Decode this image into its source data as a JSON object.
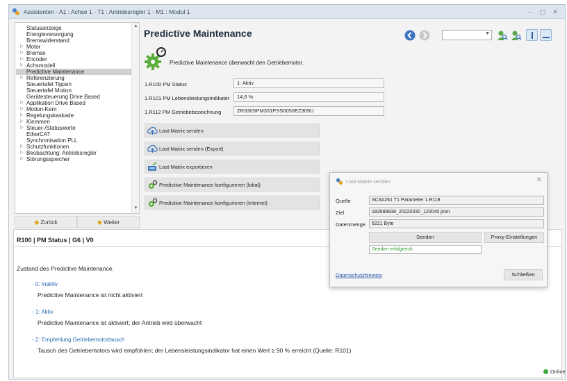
{
  "window": {
    "title": "Assistenten - A1 : Achse 1 - T1 : Antriebsregler 1 - M1 : Modul 1",
    "minimize": "–",
    "maximize": "▢",
    "close": "✕"
  },
  "nav": {
    "items": [
      {
        "label": "Statusanzeige",
        "selected": false
      },
      {
        "label": "Energieversorgung",
        "selected": false
      },
      {
        "label": "Bremswiderstand",
        "selected": false
      },
      {
        "label": "Motor",
        "selected": false,
        "expandable": true
      },
      {
        "label": "Bremse",
        "selected": false,
        "expandable": true
      },
      {
        "label": "Encoder",
        "selected": false,
        "expandable": true
      },
      {
        "label": "Achsmodell",
        "selected": false,
        "expandable": true
      },
      {
        "label": "Predictive Maintenance",
        "selected": true
      },
      {
        "label": "Referenzierung",
        "selected": false,
        "expandable": true
      },
      {
        "label": "Steuertafel Tippen",
        "selected": false
      },
      {
        "label": "Steuertafel Motion",
        "selected": false
      },
      {
        "label": "Gerätesteuerung Drive Based",
        "selected": false
      },
      {
        "label": "Applikation Drive Based",
        "selected": false,
        "expandable": true
      },
      {
        "label": "Motion-Kern",
        "selected": false,
        "expandable": true
      },
      {
        "label": "Regelungskaskade",
        "selected": false,
        "expandable": true
      },
      {
        "label": "Klemmen",
        "selected": false,
        "expandable": true
      },
      {
        "label": "Steuer-/Statusworte",
        "selected": false,
        "expandable": true
      },
      {
        "label": "EtherCAT",
        "selected": false
      },
      {
        "label": "Synchronisation PLL",
        "selected": false
      },
      {
        "label": "Schutzfunktionen",
        "selected": false,
        "expandable": true
      },
      {
        "label": "Beobachtung: Antriebsregler",
        "selected": false,
        "expandable": true
      },
      {
        "label": "Störungsspeicher",
        "selected": false,
        "expandable": true
      }
    ],
    "back_label": "Zurück",
    "next_label": "Weiter"
  },
  "page": {
    "title": "Predictive Maintenance",
    "intro": "Predictive Maintenance überwacht den Getriebemotor."
  },
  "params": [
    {
      "label": "1.R100 PM Status",
      "value": "1: Aktiv"
    },
    {
      "label": "1.R101 PM Lebensleistungsindikator",
      "value": "14,6 %"
    },
    {
      "label": "1.R112 PM Getriebebezeichnung",
      "value": "ZR330SPM331PSS0050EZ309U"
    }
  ],
  "actions": [
    {
      "label": "Last-Matrix senden",
      "icon": "cloud-upload-icon"
    },
    {
      "label": "Last-Matrix senden (Export)",
      "icon": "cloud-upload-icon"
    },
    {
      "label": "Last-Matrix exportieren",
      "icon": "export-icon"
    },
    {
      "label": "Predictive Maintenance konfigurieren (lokal)",
      "icon": "gear-icon"
    },
    {
      "label": "Predictive Maintenance konfigurieren (Internet)",
      "icon": "gear-icon"
    }
  ],
  "description": {
    "title": "R100 | PM Status | G6 | V0",
    "intro": "Zustand des Predictive Maintenance.",
    "states": [
      {
        "key": "- 0: Inaktiv",
        "text": "Predictive Maintenance ist nicht aktiviert"
      },
      {
        "key": "- 1: Aktiv",
        "text": "Predictive Maintenance ist aktiviert; der Antrieb wird überwacht"
      },
      {
        "key": "- 2: Empfehlung Getriebemotortausch",
        "text": "Tausch des Getriebemotors wird empfohlen; der Lebensleistungsindikator hat einen Wert ≥ 90 % erreicht (Quelle: R101)"
      }
    ]
  },
  "status": {
    "online_label": "Online"
  },
  "dialog": {
    "title": "Last-Matrix senden",
    "close": "✕",
    "source_label": "Quelle",
    "source_value": "SC6A261 T1 Parameter 1.R118",
    "target_label": "Ziel",
    "target_value": "183989938_20220330_120040.json",
    "size_label": "Datenmenge",
    "size_value": "6221 Byte",
    "send_label": "Senden",
    "proxy_label": "Proxy-Einstellungen",
    "status_text": "Senden erfolgreich",
    "privacy_link": "Datenschutzhinweis",
    "close_button": "Schließen"
  },
  "colors": {
    "accent_green": "#3aa83a",
    "link_blue": "#2757a8",
    "selected_bg": "#d0d0d0"
  }
}
